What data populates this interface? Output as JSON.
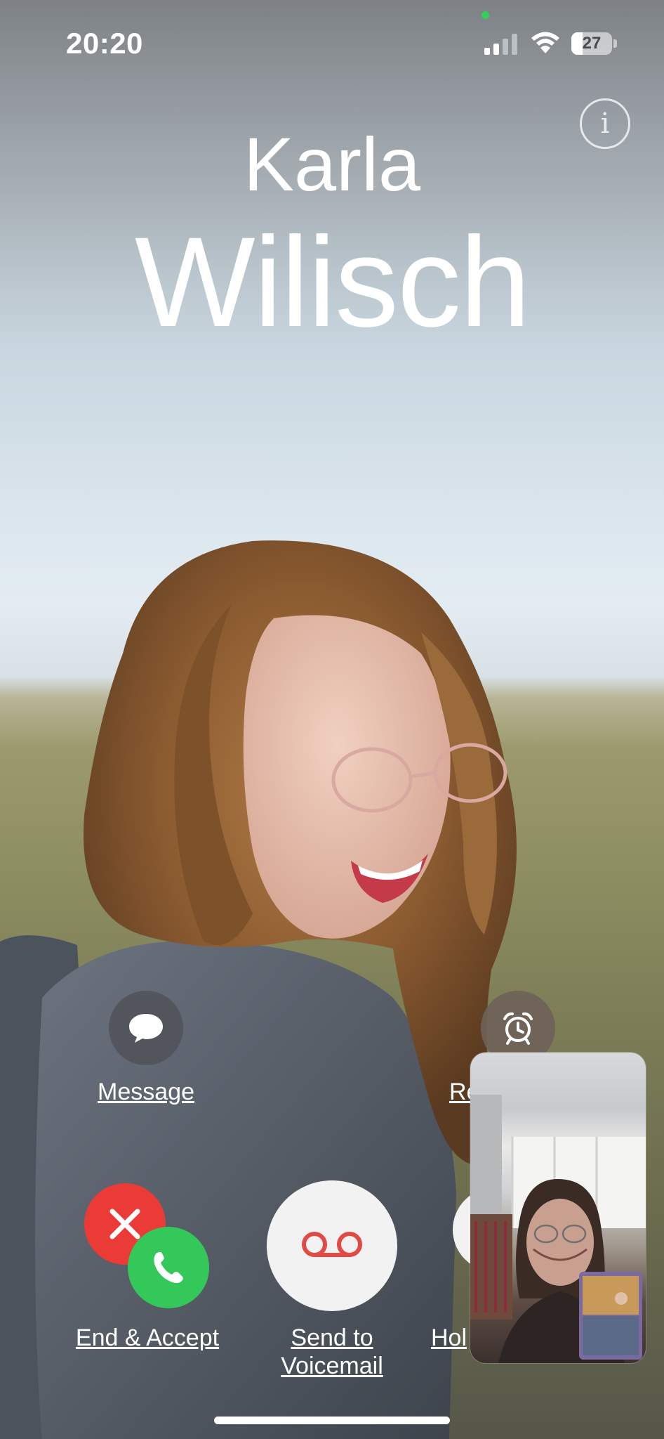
{
  "status_bar": {
    "time": "20:20",
    "battery_level": "27",
    "signal_bars_active": 2,
    "signal_bars_total": 4,
    "battery_fraction": 0.27,
    "privacy_indicator_color": "#31d158"
  },
  "caller": {
    "first_name": "Karla",
    "last_name": "Wilisch"
  },
  "actions": {
    "message": {
      "label": "Message",
      "icon": "speech-bubble-icon"
    },
    "remind": {
      "label": "Re",
      "icon": "alarm-clock-icon"
    },
    "end_accept": {
      "label": "End & Accept",
      "icons": [
        "close-icon",
        "phone-icon"
      ]
    },
    "voicemail": {
      "label_line1": "Send to",
      "label_line2": "Voicemail",
      "icon": "voicemail-icon"
    },
    "hold": {
      "label": "Hol"
    }
  },
  "colors": {
    "decline_red": "#eb3b36",
    "accept_green": "#34c85a",
    "voicemail_red": "#e14b45",
    "action_gray": "#5b5b60"
  },
  "icons": {
    "info": "info-icon",
    "signal": "signal-icon",
    "wifi": "wifi-icon",
    "battery": "battery-icon"
  }
}
